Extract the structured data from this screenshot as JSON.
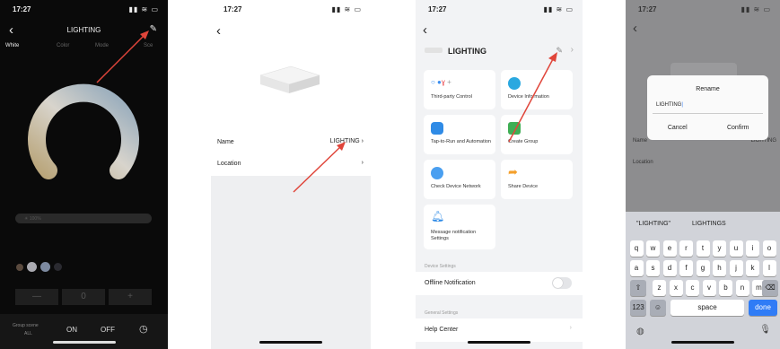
{
  "screens": [
    {
      "status_time": "17:27",
      "title": "LIGHTING",
      "tabs": [
        "White",
        "Color",
        "Mode",
        "Sce"
      ],
      "slider_text": "☀ 100%",
      "steps": [
        "—",
        "0",
        "+"
      ],
      "bottom": {
        "group_label": "Group scene",
        "group_sub": "ALL",
        "on": "ON",
        "off": "OFF"
      }
    },
    {
      "status_time": "17:27",
      "rows": [
        {
          "label": "Name",
          "value": "LIGHTING"
        },
        {
          "label": "Location",
          "value": ""
        }
      ]
    },
    {
      "status_time": "17:27",
      "device_name": "LIGHTING",
      "cards": [
        {
          "label": "Third-party Control",
          "color": "#ffffff"
        },
        {
          "label": "Device Information",
          "color": "#2aa8e0"
        },
        {
          "label": "Tap-to-Run and Automation",
          "color": "#2f8be6"
        },
        {
          "label": "Create Group",
          "color": "#3fae54"
        },
        {
          "label": "Check Device Network",
          "color": "#4a9ff0"
        },
        {
          "label": "Share Device",
          "color": "#f4a02b"
        },
        {
          "label": "Message notification Settings",
          "color": "#2f8be6"
        }
      ],
      "section_device": "Device Settings",
      "offline_notification": "Offline Notification",
      "section_general": "General Settings",
      "help_center": "Help Center"
    },
    {
      "status_time": "17:27",
      "dialog": {
        "title": "Rename",
        "input_value": "LIGHTING",
        "cancel": "Cancel",
        "confirm": "Confirm"
      },
      "bg_name_label": "Name",
      "bg_name_value": "LIGHTING",
      "bg_location_label": "Location",
      "suggestions": [
        "\"LIGHTING\"",
        "LIGHTINGS"
      ],
      "rows": [
        [
          "q",
          "w",
          "e",
          "r",
          "t",
          "y",
          "u",
          "i",
          "o"
        ],
        [
          "a",
          "s",
          "d",
          "f",
          "g",
          "h",
          "j",
          "k",
          "l"
        ],
        [
          "z",
          "x",
          "c",
          "v",
          "b",
          "n",
          "m"
        ]
      ],
      "num_key": "123",
      "space": "space",
      "done": "done"
    }
  ],
  "colors": {
    "arrow": "#e0453a",
    "accent_blue": "#2f7cf6"
  }
}
